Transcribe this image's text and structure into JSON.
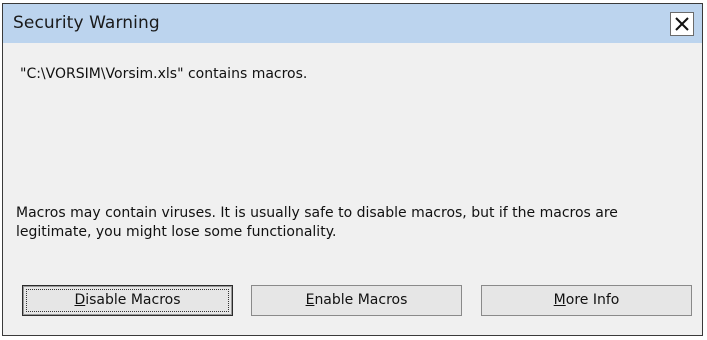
{
  "dialog": {
    "title": "Security Warning",
    "message": "\"C:\\VORSIM\\Vorsim.xls\" contains macros.",
    "detail": "Macros may contain viruses. It is usually safe to disable macros, but if the macros are legitimate, you might lose some functionality."
  },
  "buttons": {
    "disable": {
      "accel": "D",
      "rest": "isable Macros"
    },
    "enable": {
      "accel": "E",
      "rest": "nable Macros"
    },
    "more": {
      "accel": "M",
      "rest": "ore Info"
    }
  },
  "icons": {
    "close": "close-icon"
  },
  "colors": {
    "titlebar": "#bcd4ee",
    "background": "#f0f0f0"
  }
}
